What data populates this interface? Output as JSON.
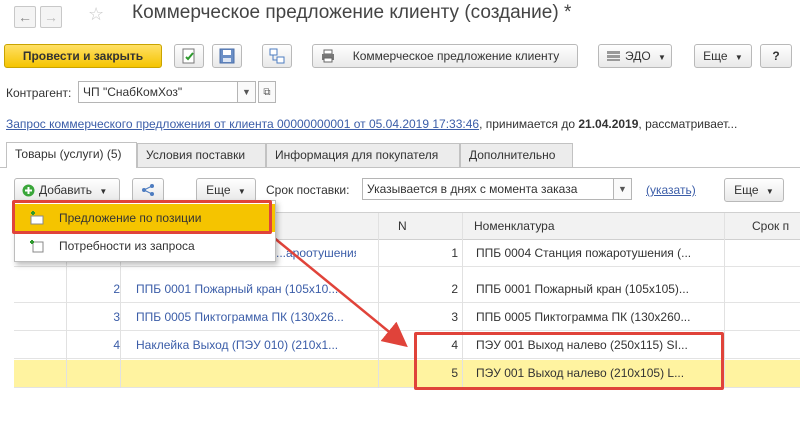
{
  "window": {
    "title": "Коммерческое предложение клиенту (создание) *",
    "star_icon": "star-icon",
    "back_icon": "arrow-left-icon",
    "forward_icon": "arrow-right-icon"
  },
  "toolbar": {
    "post_close_label": "Провести и закрыть",
    "print_doc_label": "Коммерческое предложение клиенту",
    "edo_label": "ЭДО",
    "more_label": "Еще",
    "help_label": "?"
  },
  "counterparty": {
    "label": "Контрагент:",
    "value": "ЧП \"СнабКомХоз\""
  },
  "request_line": {
    "link_text": "Запрос коммерческого предложения от клиента 00000000001 от 05.04.2019 17:33:46",
    "suffix_text": ", принимается до ",
    "date_text": "21.04.2019",
    "tail_text": ", рассматривает..."
  },
  "tabs": [
    {
      "label": "Товары (услуги) (5)"
    },
    {
      "label": "Условия поставки"
    },
    {
      "label": "Информация для покупателя"
    },
    {
      "label": "Дополнительно"
    }
  ],
  "table_toolbar": {
    "add_label": "Добавить",
    "more_label": "Еще",
    "delivery_label": "Срок поставки:",
    "delivery_value": "Указывается в днях с момента заказа",
    "specify_link": "(указать)",
    "more_right_label": "Еще"
  },
  "add_menu": {
    "items": [
      {
        "label": "Предложение по позиции"
      },
      {
        "label": "Потребности из запроса"
      }
    ]
  },
  "grid": {
    "columns": [
      "N",
      "Номенклатура",
      "Срок п"
    ],
    "left_rows": [
      {
        "num": "",
        "name": "...ароотушения..."
      },
      {
        "num": "2",
        "name": "ППБ 0001 Пожарный кран (105х10..."
      },
      {
        "num": "3",
        "name": "ППБ 0005 Пиктограмма ПК (130х26..."
      },
      {
        "num": "4",
        "name": "Наклейка Выход (ПЭУ 010) (210х1..."
      },
      {
        "num": "",
        "name": ""
      }
    ],
    "right_rows": [
      {
        "n": "1",
        "name": "ППБ 0004 Станция пожаротушения (..."
      },
      {
        "n": "2",
        "name": "ППБ 0001 Пожарный кран (105х105)..."
      },
      {
        "n": "3",
        "name": "ППБ 0005 Пиктограмма ПК (130х260..."
      },
      {
        "n": "4",
        "name": "ПЭУ 001 Выход налево (250х115) SI..."
      },
      {
        "n": "5",
        "name": "ПЭУ 001 Выход налево (210х105) L..."
      }
    ]
  },
  "colors": {
    "primary": "#f5c400",
    "highlight_row": "#fff3a0",
    "link": "#3b5da8",
    "annotation_red": "#e0433a"
  }
}
